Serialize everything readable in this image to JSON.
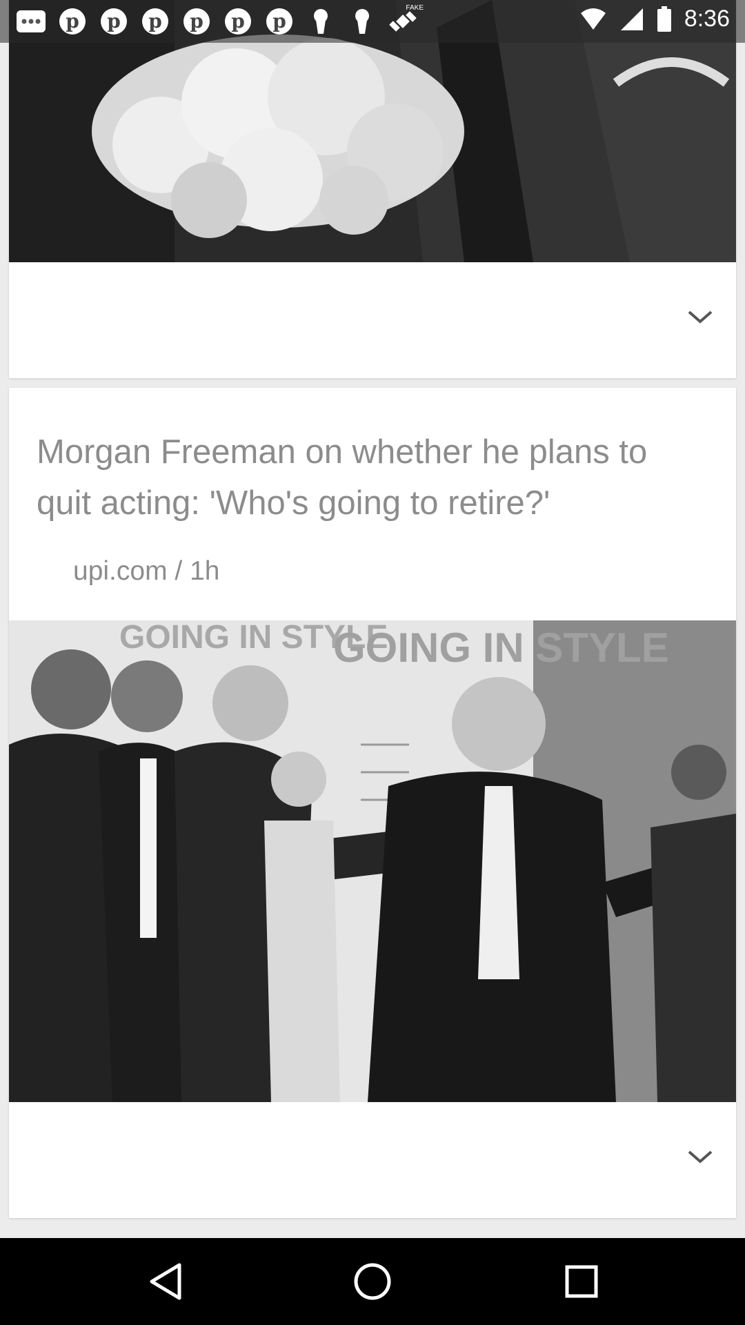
{
  "status_bar": {
    "time": "8:36",
    "icons": [
      "more-icon",
      "pinterest-icon",
      "pinterest-icon",
      "pinterest-icon",
      "pinterest-icon",
      "pinterest-icon",
      "pinterest-icon",
      "keyhole-icon",
      "keyhole-icon",
      "fake-gps-icon",
      "wifi-icon",
      "signal-icon",
      "battery-icon"
    ],
    "fake_gps_label": "FAKE"
  },
  "cards": [
    {
      "has_image": true,
      "image_desc_icon": "photo-flowers"
    },
    {
      "headline": "Morgan Freeman on whether he plans to quit acting: 'Who's going to retire?'",
      "source": "upi.com / 1h",
      "image_banner_text": "GOING IN STYLE"
    }
  ],
  "nav": {
    "icons": [
      "back-icon",
      "home-icon",
      "recents-icon"
    ]
  },
  "colors": {
    "background": "#ececec",
    "card": "#ffffff",
    "text_gray": "#8c8c8c",
    "nav_bar": "#000000"
  }
}
